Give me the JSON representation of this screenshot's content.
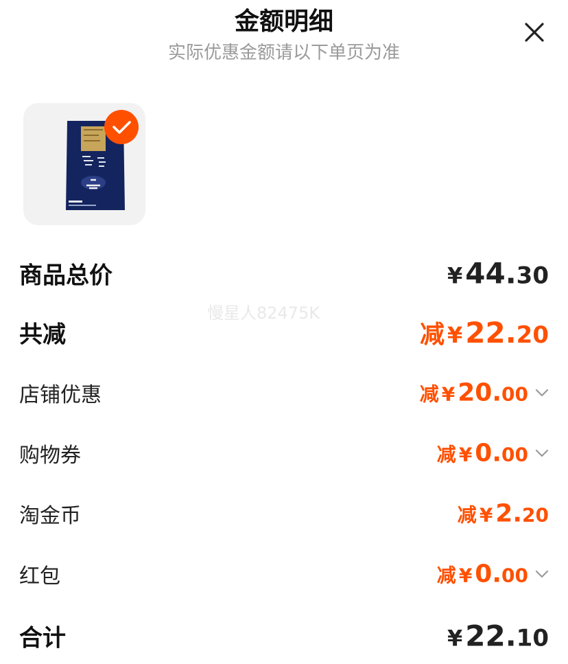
{
  "header": {
    "title": "金额明细",
    "subtitle": "实际优惠金额请以下单页为准"
  },
  "watermark": "慢星人82475K",
  "rows": {
    "total_price": {
      "label": "商品总价",
      "yen": "¥",
      "int": "44.",
      "dec": "30"
    },
    "total_discount": {
      "label": "共减",
      "prefix": "减",
      "yen": "¥",
      "int": "22.",
      "dec": "20"
    },
    "shop_discount": {
      "label": "店铺优惠",
      "prefix": "减",
      "yen": "¥",
      "int": "20.",
      "dec": "00"
    },
    "coupon": {
      "label": "购物券",
      "prefix": "减",
      "yen": "¥",
      "int": "0.",
      "dec": "00"
    },
    "taojin_coin": {
      "label": "淘金币",
      "prefix": "减",
      "yen": "¥",
      "int": "2.",
      "dec": "20"
    },
    "red_packet": {
      "label": "红包",
      "prefix": "减",
      "yen": "¥",
      "int": "0.",
      "dec": "00"
    },
    "sum": {
      "label": "合计",
      "yen": "¥",
      "int": "22.",
      "dec": "10"
    }
  },
  "colors": {
    "accent": "#ff5000",
    "text": "#222222",
    "subtitle": "#9a9a9a"
  },
  "icons": [
    "close-icon",
    "check-icon",
    "chevron-down-icon"
  ]
}
